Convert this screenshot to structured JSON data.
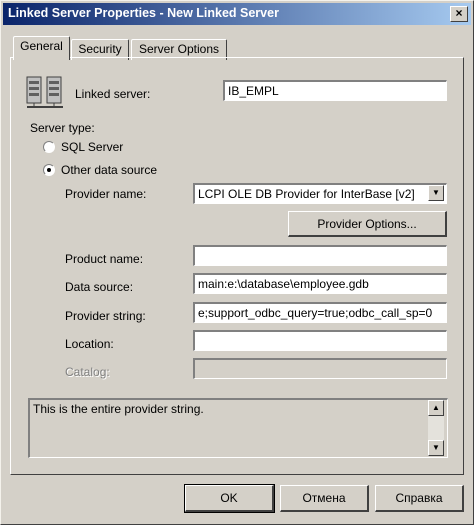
{
  "window": {
    "title": "Linked Server Properties - New Linked Server",
    "close_glyph": "×"
  },
  "tabs": [
    {
      "label": "General",
      "active": true
    },
    {
      "label": "Security",
      "active": false
    },
    {
      "label": "Server Options",
      "active": false
    }
  ],
  "general": {
    "linked_server_label": "Linked server:",
    "linked_server_value": "IB_EMPL",
    "server_type_label": "Server type:",
    "radio_sql": "SQL Server",
    "radio_other": "Other data source",
    "selected_radio": "Other data source",
    "provider_name_label": "Provider name:",
    "provider_name_value": "LCPI OLE DB Provider for InterBase [v2]",
    "provider_options_button": "Provider Options...",
    "product_name_label": "Product name:",
    "product_name_value": "",
    "data_source_label": "Data source:",
    "data_source_value": "main:e:\\database\\employee.gdb",
    "provider_string_label": "Provider string:",
    "provider_string_value": "e;support_odbc_query=true;odbc_call_sp=0",
    "location_label": "Location:",
    "location_value": "",
    "catalog_label": "Catalog:",
    "catalog_value": "",
    "description": "This is the entire provider string."
  },
  "footer": {
    "ok_label": "OK",
    "cancel_label": "Отмена",
    "help_label": "Справка"
  },
  "icons": {
    "server_icon": "server-icon",
    "dropdown_icon": "chevron-down-icon",
    "scroll_up_icon": "scroll-up-icon",
    "scroll_down_icon": "scroll-down-icon"
  }
}
